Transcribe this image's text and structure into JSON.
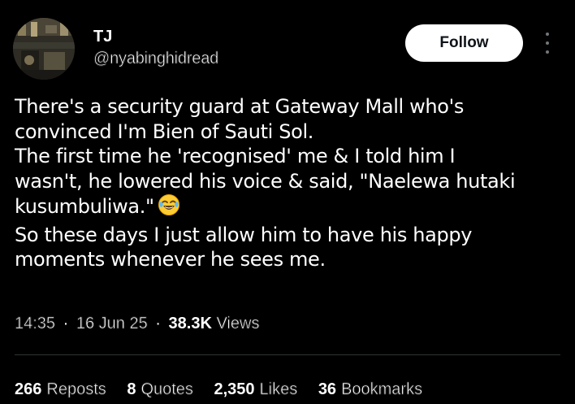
{
  "user": {
    "display_name": "TJ",
    "handle": "@nyabinghidread",
    "avatar_icon": "profile-photo"
  },
  "actions": {
    "follow_label": "Follow",
    "more_icon": "more-vertical-icon"
  },
  "tweet": {
    "lines": [
      "There's a security guard at Gateway Mall who's",
      "convinced I'm Bien of Sauti Sol.",
      "The first time he 'recognised' me & I told him I",
      "wasn't, he lowered his voice & said, \"Naelewa hutaki",
      "kusumbuliwa.\"",
      "So these days I just allow him to have his happy",
      "moments whenever he sees me."
    ],
    "emoji": "face-with-tears-of-joy"
  },
  "meta": {
    "time": "14:35",
    "date": "16 Jun 25",
    "views_count": "38.3K",
    "views_label": "Views",
    "separator": "·"
  },
  "stats": {
    "reposts": {
      "count": "266",
      "label": "Reposts"
    },
    "quotes": {
      "count": "8",
      "label": "Quotes"
    },
    "likes": {
      "count": "2,350",
      "label": "Likes"
    },
    "bookmarks": {
      "count": "36",
      "label": "Bookmarks"
    }
  },
  "colors": {
    "background": "#000000",
    "text": "#ffffff",
    "secondary": "#71767b",
    "divider": "#2f3336",
    "follow_bg": "#ffffff"
  }
}
